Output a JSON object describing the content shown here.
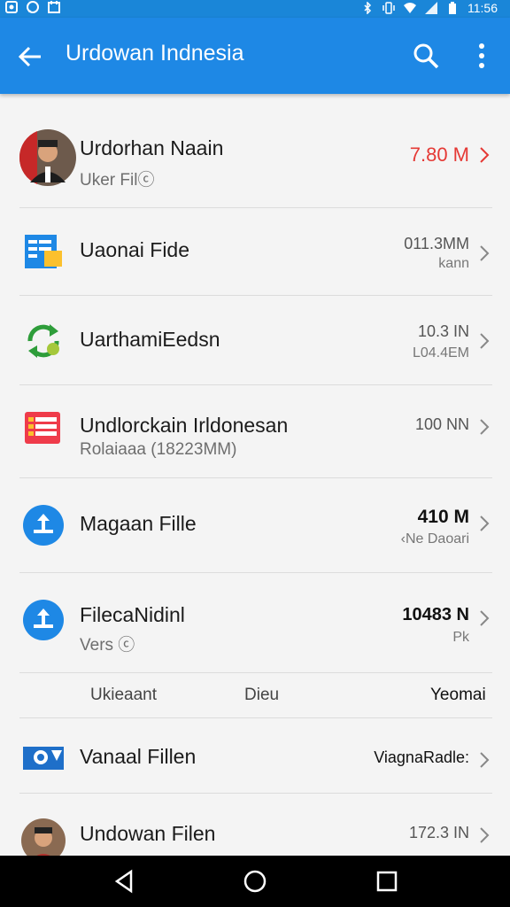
{
  "status_bar": {
    "time": "11:56",
    "left_icons": [
      "notification-icon",
      "whatsapp-icon",
      "calendar-icon"
    ],
    "right_icons": [
      "bluetooth-icon",
      "vibrate-icon",
      "wifi-icon",
      "signal-icon",
      "battery-icon"
    ]
  },
  "app_bar": {
    "title": "Urdowan Indnesia",
    "background": "#1e88e5"
  },
  "items": [
    {
      "name": "Urdorhan Naain",
      "sub": "Uker Filⓒ",
      "value": "7.80 M",
      "value2": "",
      "value_color": "#e53935",
      "icon": "avatar-icon"
    },
    {
      "name": "Uaonai Fide",
      "sub": "",
      "value": "011.3MM",
      "value2": "kann",
      "value_color": "#555555",
      "icon": "file-manager-icon"
    },
    {
      "name": "UarthamiEedsn",
      "sub": "",
      "value": "10.3 IN",
      "value2": "L04.4EM",
      "value_color": "#555555",
      "icon": "sync-icon"
    },
    {
      "name": "Undlorckain Irldonesan",
      "sub": "Rolaiaaa (18223MM)",
      "value": "100 NN",
      "value2": "",
      "value_color": "#555555",
      "icon": "document-icon"
    },
    {
      "name": "Magaan Fille",
      "sub": "",
      "value": "410 M",
      "value2": "‹Ne Daoari",
      "value_color": "#111111",
      "icon": "upload-icon"
    },
    {
      "name": "FilecaNidinl",
      "sub": "Vers ⓒ",
      "value": "10483 N",
      "value2": "Pk",
      "value_color": "#111111",
      "icon": "upload-icon"
    }
  ],
  "tabs": [
    "Ukieaant",
    "Dieu",
    "Yeomai"
  ],
  "items_bottom": [
    {
      "name": "Vanaal Fillen",
      "sub": "",
      "value": "ViagnaRadle:",
      "value2": "",
      "value_color": "#111111",
      "icon": "camera-folder-icon"
    },
    {
      "name": "Undowan Filen",
      "sub": "",
      "value": "172.3 IN",
      "value2": "",
      "value_color": "#555555",
      "icon": "avatar-icon"
    }
  ],
  "nav_bar": {
    "buttons": [
      "back-icon",
      "home-icon",
      "recents-icon"
    ]
  }
}
